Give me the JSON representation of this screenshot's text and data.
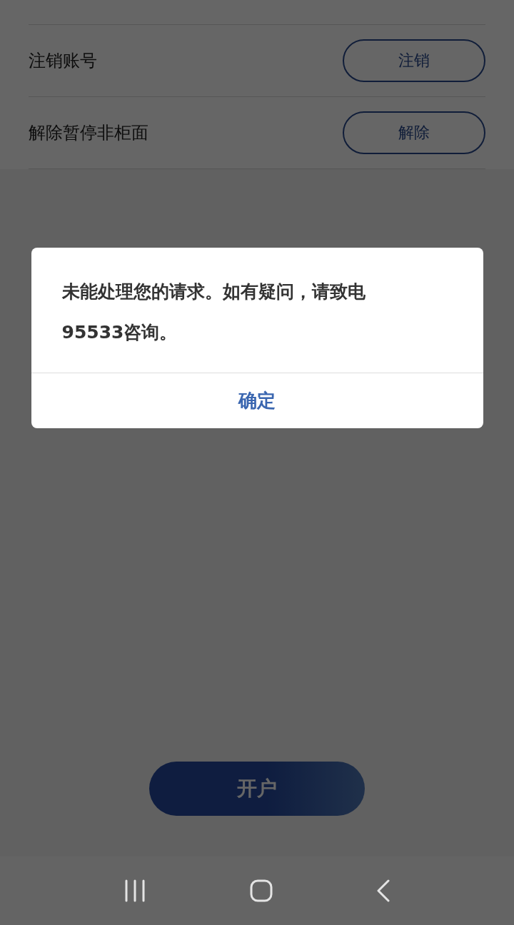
{
  "settings_rows": [
    {
      "label": "注销账号",
      "button": "注销"
    },
    {
      "label": "解除暂停非柜面",
      "button": "解除"
    }
  ],
  "open_account_button": "开户",
  "dialog": {
    "message": "未能处理您的请求。如有疑问，请致电95533咨询。",
    "confirm_button": "确定"
  },
  "nav_bar": {
    "buttons": [
      {
        "kind": "recents"
      },
      {
        "kind": "home"
      },
      {
        "kind": "back"
      }
    ]
  }
}
